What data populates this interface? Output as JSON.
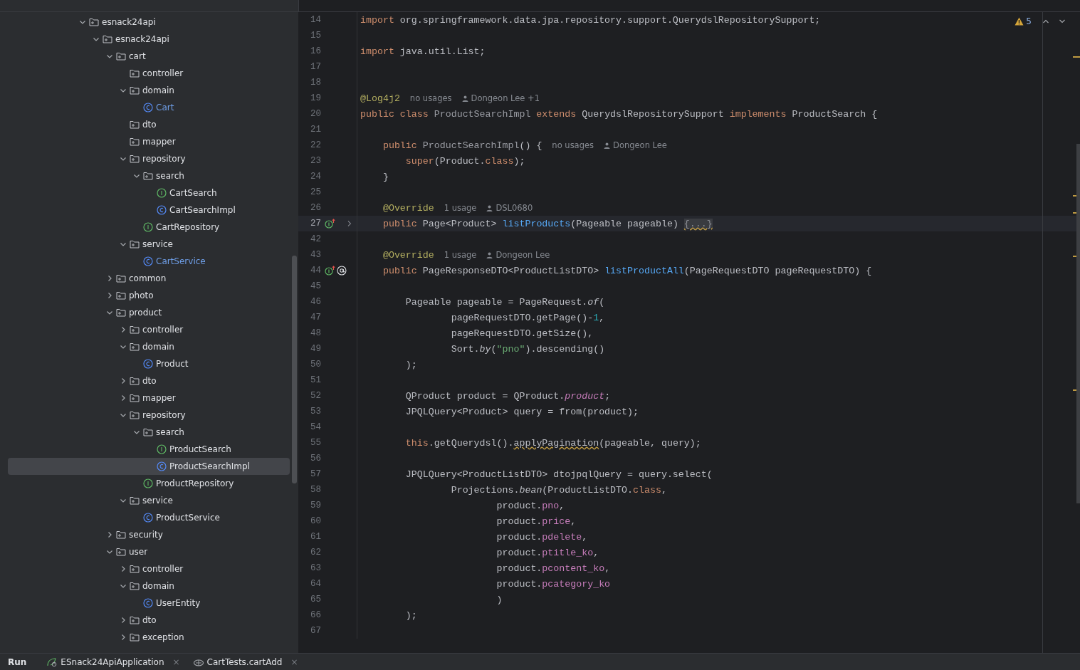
{
  "project_tree": [
    {
      "label": "esnack24api",
      "kind": "folder",
      "expanded": true,
      "selected": false,
      "modified": false,
      "children": [
        {
          "label": "esnack24api",
          "kind": "folder",
          "expanded": true,
          "selected": false,
          "modified": false,
          "children": [
            {
              "label": "cart",
              "kind": "folder",
              "expanded": true,
              "selected": false,
              "modified": false,
              "children": [
                {
                  "label": "controller",
                  "kind": "empty-folder",
                  "selected": false,
                  "modified": false
                },
                {
                  "label": "domain",
                  "kind": "folder",
                  "expanded": true,
                  "selected": false,
                  "modified": false,
                  "children": [
                    {
                      "label": "Cart",
                      "kind": "class",
                      "selected": false,
                      "modified": true
                    }
                  ]
                },
                {
                  "label": "dto",
                  "kind": "empty-folder",
                  "selected": false,
                  "modified": false
                },
                {
                  "label": "mapper",
                  "kind": "empty-folder",
                  "selected": false,
                  "modified": false
                },
                {
                  "label": "repository",
                  "kind": "folder",
                  "expanded": true,
                  "selected": false,
                  "modified": false,
                  "children": [
                    {
                      "label": "search",
                      "kind": "folder",
                      "expanded": true,
                      "selected": false,
                      "modified": false,
                      "children": [
                        {
                          "label": "CartSearch",
                          "kind": "interface",
                          "selected": false,
                          "modified": false
                        },
                        {
                          "label": "CartSearchImpl",
                          "kind": "class",
                          "selected": false,
                          "modified": false
                        }
                      ]
                    },
                    {
                      "label": "CartRepository",
                      "kind": "interface",
                      "selected": false,
                      "modified": false
                    }
                  ]
                },
                {
                  "label": "service",
                  "kind": "folder",
                  "expanded": true,
                  "selected": false,
                  "modified": false,
                  "children": [
                    {
                      "label": "CartService",
                      "kind": "class",
                      "selected": false,
                      "modified": true
                    }
                  ]
                }
              ]
            },
            {
              "label": "common",
              "kind": "folder",
              "expanded": false,
              "selected": false,
              "modified": false
            },
            {
              "label": "photo",
              "kind": "folder",
              "expanded": false,
              "selected": false,
              "modified": false
            },
            {
              "label": "product",
              "kind": "folder",
              "expanded": true,
              "selected": false,
              "modified": false,
              "children": [
                {
                  "label": "controller",
                  "kind": "folder",
                  "expanded": false,
                  "selected": false,
                  "modified": false
                },
                {
                  "label": "domain",
                  "kind": "folder",
                  "expanded": true,
                  "selected": false,
                  "modified": false,
                  "children": [
                    {
                      "label": "Product",
                      "kind": "class",
                      "selected": false,
                      "modified": false
                    }
                  ]
                },
                {
                  "label": "dto",
                  "kind": "folder",
                  "expanded": false,
                  "selected": false,
                  "modified": false
                },
                {
                  "label": "mapper",
                  "kind": "folder",
                  "expanded": false,
                  "selected": false,
                  "modified": false
                },
                {
                  "label": "repository",
                  "kind": "folder",
                  "expanded": true,
                  "selected": false,
                  "modified": false,
                  "children": [
                    {
                      "label": "search",
                      "kind": "folder",
                      "expanded": true,
                      "selected": false,
                      "modified": false,
                      "children": [
                        {
                          "label": "ProductSearch",
                          "kind": "interface",
                          "selected": false,
                          "modified": false
                        },
                        {
                          "label": "ProductSearchImpl",
                          "kind": "class",
                          "selected": true,
                          "modified": false
                        }
                      ]
                    },
                    {
                      "label": "ProductRepository",
                      "kind": "interface",
                      "selected": false,
                      "modified": false
                    }
                  ]
                },
                {
                  "label": "service",
                  "kind": "folder",
                  "expanded": true,
                  "selected": false,
                  "modified": false,
                  "children": [
                    {
                      "label": "ProductService",
                      "kind": "class",
                      "selected": false,
                      "modified": false
                    }
                  ]
                }
              ]
            },
            {
              "label": "security",
              "kind": "folder",
              "expanded": false,
              "selected": false,
              "modified": false
            },
            {
              "label": "user",
              "kind": "folder",
              "expanded": true,
              "selected": false,
              "modified": false,
              "children": [
                {
                  "label": "controller",
                  "kind": "folder",
                  "expanded": false,
                  "selected": false,
                  "modified": false
                },
                {
                  "label": "domain",
                  "kind": "folder",
                  "expanded": true,
                  "selected": false,
                  "modified": false,
                  "children": [
                    {
                      "label": "UserEntity",
                      "kind": "class",
                      "selected": false,
                      "modified": false
                    }
                  ]
                },
                {
                  "label": "dto",
                  "kind": "folder",
                  "expanded": false,
                  "selected": false,
                  "modified": false
                },
                {
                  "label": "exception",
                  "kind": "folder",
                  "expanded": false,
                  "selected": false,
                  "modified": false
                }
              ]
            }
          ]
        }
      ]
    }
  ],
  "editor": {
    "problems": {
      "count": "5"
    },
    "lines": [
      {
        "n": "14",
        "current": false,
        "code": [
          {
            "kind": "kw",
            "text": "import "
          },
          {
            "kind": "plain",
            "text": "org.springframework.data.jpa.repository.support.QuerydslRepositorySupport;"
          }
        ]
      },
      {
        "n": "15",
        "current": false
      },
      {
        "n": "16",
        "current": false,
        "code": [
          {
            "kind": "kw",
            "text": "import "
          },
          {
            "kind": "plain",
            "text": "java.util.List;"
          }
        ]
      },
      {
        "n": "17",
        "current": false
      },
      {
        "n": "18",
        "current": false
      },
      {
        "n": "19",
        "current": false,
        "code": [
          {
            "kind": "ann",
            "text": "@Log4j2"
          }
        ],
        "usages": "no usages",
        "author": "Dongeon Lee +1"
      },
      {
        "n": "20",
        "current": false,
        "code": [
          {
            "kind": "kw",
            "text": "public class "
          },
          {
            "kind": "dim",
            "text": "ProductSearchImpl"
          },
          {
            "kind": "kw",
            "text": " extends "
          },
          {
            "kind": "plain",
            "text": "QuerydslRepositorySupport"
          },
          {
            "kind": "kw",
            "text": " implements "
          },
          {
            "kind": "plain",
            "text": "ProductSearch {"
          }
        ]
      },
      {
        "n": "21",
        "current": false
      },
      {
        "n": "22",
        "current": false,
        "code": [
          {
            "kind": "kw",
            "text": "    public "
          },
          {
            "kind": "dim",
            "text": "ProductSearchImpl"
          },
          {
            "kind": "plain",
            "text": "() {"
          }
        ],
        "usages": "no usages",
        "author": "Dongeon Lee"
      },
      {
        "n": "23",
        "current": false,
        "code": [
          {
            "kind": "kw",
            "text": "        super"
          },
          {
            "kind": "plain",
            "text": "(Product."
          },
          {
            "kind": "kw",
            "text": "class"
          },
          {
            "kind": "plain",
            "text": ");"
          }
        ]
      },
      {
        "n": "24",
        "current": false,
        "code": [
          {
            "kind": "plain",
            "text": "    }"
          }
        ]
      },
      {
        "n": "25",
        "current": false
      },
      {
        "n": "26",
        "current": false,
        "code": [
          {
            "kind": "ann",
            "text": "    @Override"
          }
        ],
        "usages": "1 usage",
        "author": "DSL0680"
      },
      {
        "n": "27",
        "current": true,
        "gutter": [
          {
            "kind": "implements"
          }
        ],
        "folded": true,
        "code": [
          {
            "kind": "kw",
            "text": "    public "
          },
          {
            "kind": "plain",
            "text": "Page<Product> "
          },
          {
            "kind": "fn",
            "text": "listProducts"
          },
          {
            "kind": "plain",
            "text": "(Pageable pageable) "
          },
          {
            "kind": "fold",
            "text": "{...}"
          }
        ]
      },
      {
        "n": "42",
        "current": false
      },
      {
        "n": "43",
        "current": false,
        "code": [
          {
            "kind": "ann",
            "text": "    @Override"
          }
        ],
        "usages": "1 usage",
        "author": "Dongeon Lee"
      },
      {
        "n": "44",
        "current": false,
        "gutter": [
          {
            "kind": "implements"
          },
          {
            "kind": "bean"
          }
        ],
        "code": [
          {
            "kind": "kw",
            "text": "    public "
          },
          {
            "kind": "plain",
            "text": "PageResponseDTO<ProductListDTO> "
          },
          {
            "kind": "fn",
            "text": "listProductAll"
          },
          {
            "kind": "plain",
            "text": "(PageRequestDTO pageRequestDTO) {"
          }
        ]
      },
      {
        "n": "45",
        "current": false
      },
      {
        "n": "46",
        "current": false,
        "code": [
          {
            "kind": "plain",
            "text": "        Pageable pageable = PageRequest."
          },
          {
            "kind": "static",
            "text": "of"
          },
          {
            "kind": "plain",
            "text": "("
          }
        ]
      },
      {
        "n": "47",
        "current": false,
        "code": [
          {
            "kind": "plain",
            "text": "                pageRequestDTO.getPage()-"
          },
          {
            "kind": "num",
            "text": "1"
          },
          {
            "kind": "plain",
            "text": ","
          }
        ]
      },
      {
        "n": "48",
        "current": false,
        "code": [
          {
            "kind": "plain",
            "text": "                pageRequestDTO.getSize(),"
          }
        ]
      },
      {
        "n": "49",
        "current": false,
        "code": [
          {
            "kind": "plain",
            "text": "                Sort."
          },
          {
            "kind": "static",
            "text": "by"
          },
          {
            "kind": "plain",
            "text": "("
          },
          {
            "kind": "str",
            "text": "\"pno\""
          },
          {
            "kind": "plain",
            "text": ").descending()"
          }
        ]
      },
      {
        "n": "50",
        "current": false,
        "code": [
          {
            "kind": "plain",
            "text": "        );"
          }
        ]
      },
      {
        "n": "51",
        "current": false
      },
      {
        "n": "52",
        "current": false,
        "code": [
          {
            "kind": "plain",
            "text": "        QProduct product = QProduct."
          },
          {
            "kind": "static-field",
            "text": "product"
          },
          {
            "kind": "plain",
            "text": ";"
          }
        ]
      },
      {
        "n": "53",
        "current": false,
        "code": [
          {
            "kind": "plain",
            "text": "        JPQLQuery<Product> query = from(product);"
          }
        ]
      },
      {
        "n": "54",
        "current": false
      },
      {
        "n": "55",
        "current": false,
        "code": [
          {
            "kind": "kw",
            "text": "        this"
          },
          {
            "kind": "plain",
            "text": ".getQuerydsl()."
          },
          {
            "kind": "warn",
            "text": "applyPagination"
          },
          {
            "kind": "plain",
            "text": "(pageable, query);"
          }
        ]
      },
      {
        "n": "56",
        "current": false
      },
      {
        "n": "57",
        "current": false,
        "code": [
          {
            "kind": "plain",
            "text": "        JPQLQuery<ProductListDTO> dtojpqlQuery = query.select("
          }
        ]
      },
      {
        "n": "58",
        "current": false,
        "code": [
          {
            "kind": "plain",
            "text": "                Projections."
          },
          {
            "kind": "static",
            "text": "bean"
          },
          {
            "kind": "plain",
            "text": "(ProductListDTO."
          },
          {
            "kind": "kw",
            "text": "class"
          },
          {
            "kind": "plain",
            "text": ","
          }
        ]
      },
      {
        "n": "59",
        "current": false,
        "code": [
          {
            "kind": "plain",
            "text": "                        product."
          },
          {
            "kind": "field",
            "text": "pno"
          },
          {
            "kind": "plain",
            "text": ","
          }
        ]
      },
      {
        "n": "60",
        "current": false,
        "code": [
          {
            "kind": "plain",
            "text": "                        product."
          },
          {
            "kind": "field",
            "text": "price"
          },
          {
            "kind": "plain",
            "text": ","
          }
        ]
      },
      {
        "n": "61",
        "current": false,
        "code": [
          {
            "kind": "plain",
            "text": "                        product."
          },
          {
            "kind": "field",
            "text": "pdelete"
          },
          {
            "kind": "plain",
            "text": ","
          }
        ]
      },
      {
        "n": "62",
        "current": false,
        "code": [
          {
            "kind": "plain",
            "text": "                        product."
          },
          {
            "kind": "field",
            "text": "ptitle_ko"
          },
          {
            "kind": "plain",
            "text": ","
          }
        ]
      },
      {
        "n": "63",
        "current": false,
        "code": [
          {
            "kind": "plain",
            "text": "                        product."
          },
          {
            "kind": "field",
            "text": "pcontent_ko"
          },
          {
            "kind": "plain",
            "text": ","
          }
        ]
      },
      {
        "n": "64",
        "current": false,
        "code": [
          {
            "kind": "plain",
            "text": "                        product."
          },
          {
            "kind": "field",
            "text": "pcategory_ko"
          }
        ]
      },
      {
        "n": "65",
        "current": false,
        "code": [
          {
            "kind": "plain",
            "text": "                        )"
          }
        ]
      },
      {
        "n": "66",
        "current": false,
        "code": [
          {
            "kind": "plain",
            "text": "        );"
          }
        ]
      },
      {
        "n": "67",
        "current": false
      }
    ]
  },
  "bottom_bar": {
    "title": "Run",
    "tabs": [
      {
        "label": "ESnack24ApiApplication",
        "kind": "app",
        "close": "×"
      },
      {
        "label": "CartTests.cartAdd",
        "kind": "test",
        "close": "×"
      }
    ]
  }
}
